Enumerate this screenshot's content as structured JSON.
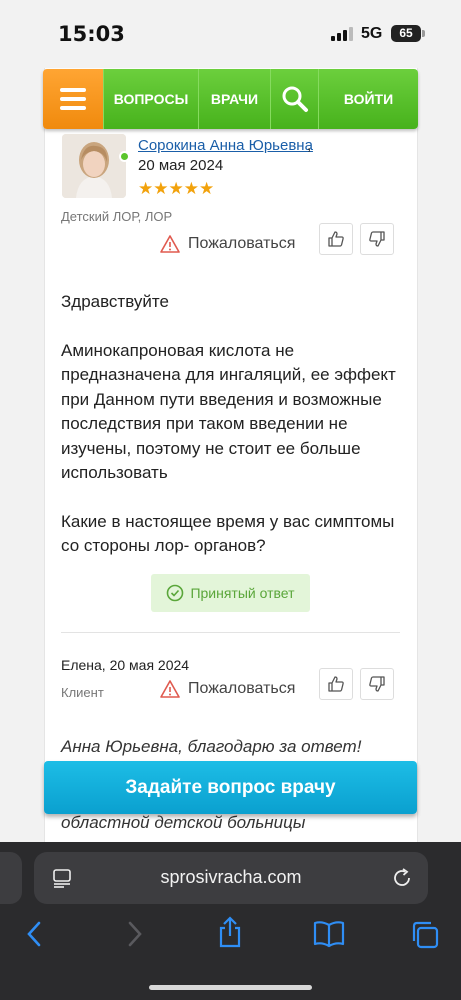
{
  "status_bar": {
    "time": "15:03",
    "network": "5G",
    "battery": "65"
  },
  "nav": {
    "menu_icon": "hamburger-icon",
    "questions": "ВОПРОСЫ",
    "doctors": "ВРАЧИ",
    "search_icon": "search-icon",
    "login": "ВОЙТИ",
    "colors": {
      "menu": "#f08a0d",
      "nav": "#4fb823"
    }
  },
  "answer": {
    "author": "Сорокина Анна Юрьевна",
    "comma": ",",
    "date": "20 мая 2024",
    "rating": "★★★★★",
    "specialty": "Детский ЛОР, ЛОР",
    "complain": "Пожаловаться",
    "paragraphs": [
      "Здравствуйте",
      "Аминокапроновая кислота не предназначена для ингаляций, ее эффект при Данном пути введения и возможные последствия при таком введении не изучены, поэтому не стоит ее больше использовать",
      "Какие в настоящее время у вас симптомы со стороны лор- органов?"
    ],
    "accepted_label": "Принятый ответ"
  },
  "reply": {
    "name_date": "Елена, 20 мая 2024",
    "role": "Клиент",
    "complain": "Пожаловаться",
    "text_line1": "Анна Юрьевна, благодарю за ответ!",
    "text_line2": "областной детской больницы"
  },
  "cta": {
    "label": "Задайте вопрос врачу",
    "color": "#0aa0cf"
  },
  "browser": {
    "url": "sprosivracha.com"
  }
}
